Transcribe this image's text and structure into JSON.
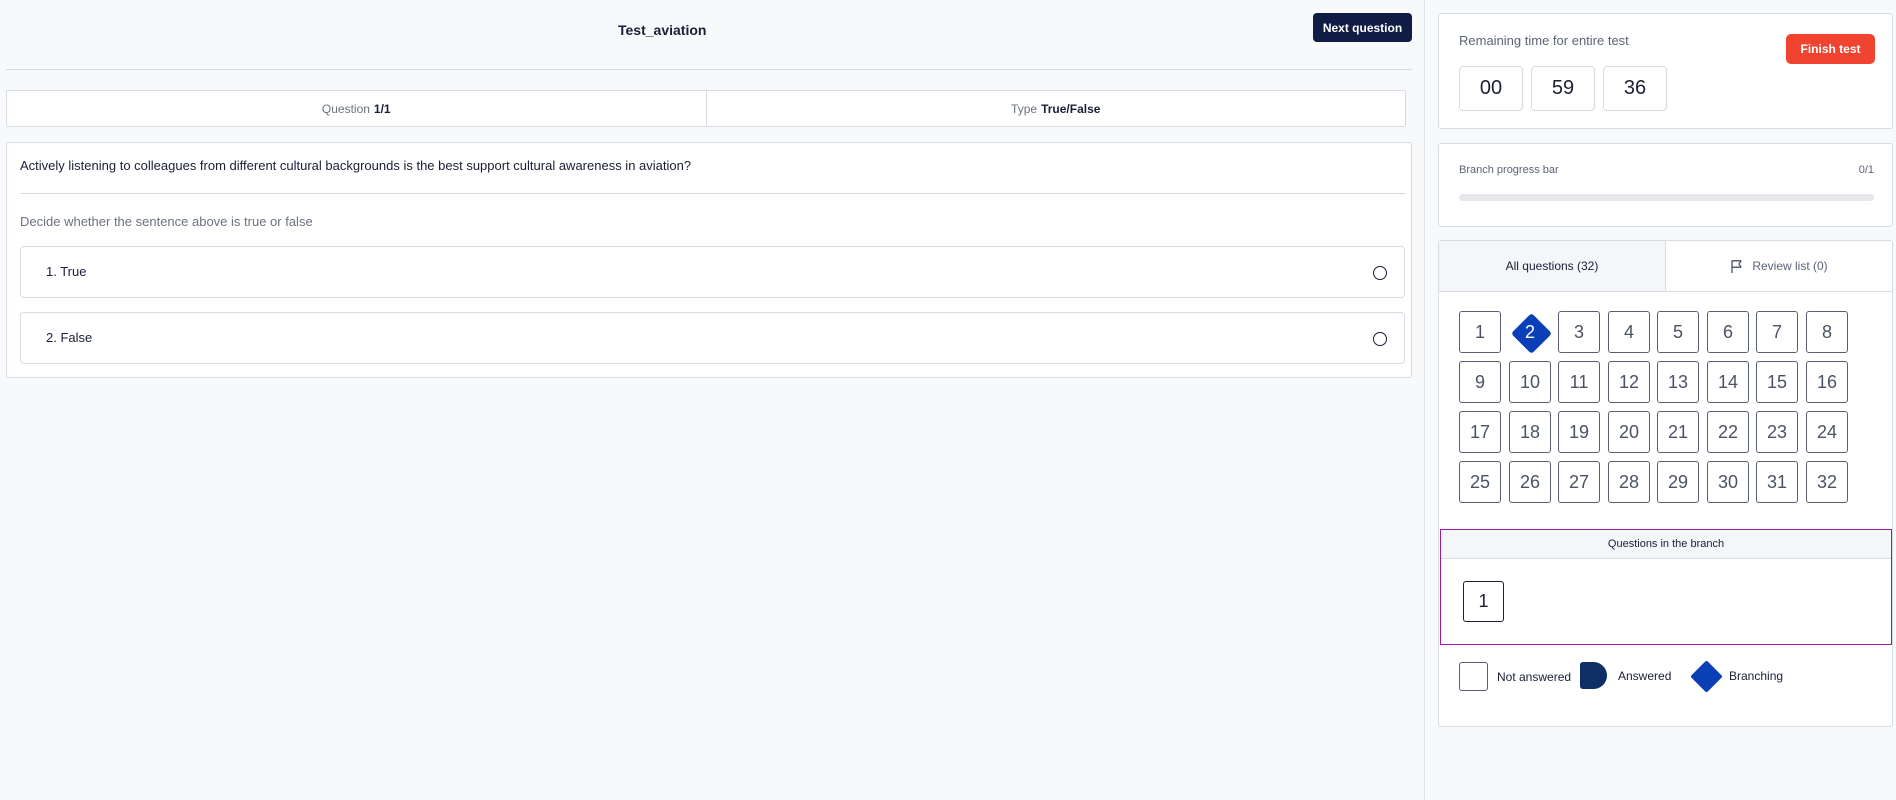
{
  "header": {
    "test_title": "Test_aviation",
    "next_button": "Next question"
  },
  "question_info": {
    "question_label": "Question",
    "question_value": "1/1",
    "type_label": "Type",
    "type_value": "True/False"
  },
  "question": {
    "text": "Actively listening to colleagues from different cultural backgrounds is the  best support cultural awareness in aviation?",
    "hint": "Decide whether the sentence above is true or false",
    "options": [
      {
        "label": "1. True",
        "selected": false
      },
      {
        "label": "2. False",
        "selected": false
      }
    ]
  },
  "timer": {
    "label": "Remaining time for entire test",
    "finish_button": "Finish test",
    "hours": "00",
    "minutes": "59",
    "seconds": "36"
  },
  "branch_progress": {
    "label": "Branch progress bar",
    "count": "0/1",
    "fraction": 0
  },
  "tabs": {
    "all_questions": "All questions (32)",
    "review_list": "Review list (0)",
    "review_icon": "flag-icon"
  },
  "questions": {
    "numbers": [
      "1",
      "2",
      "3",
      "4",
      "5",
      "6",
      "7",
      "8",
      "9",
      "10",
      "11",
      "12",
      "13",
      "14",
      "15",
      "16",
      "17",
      "18",
      "19",
      "20",
      "21",
      "22",
      "23",
      "24",
      "25",
      "26",
      "27",
      "28",
      "29",
      "30",
      "31",
      "32"
    ],
    "branching_number": "2"
  },
  "branch": {
    "title": "Questions in the branch",
    "questions": [
      "1"
    ]
  },
  "legend": {
    "not_answered": "Not answered",
    "answered": "Answered",
    "branching": "Branching"
  },
  "colors": {
    "primary_dark": "#111c44",
    "finish_red": "#f04430",
    "branching_blue": "#0b3fb8",
    "answered_navy": "#0d2e66",
    "branch_border": "#9b1b9b"
  }
}
